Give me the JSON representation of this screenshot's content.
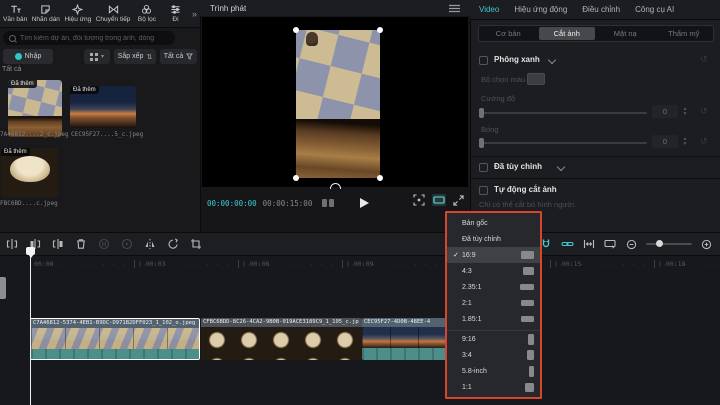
{
  "colors": {
    "accent_cyan": "#3ec9cc",
    "annotation_red": "#d6452c",
    "teal_strip": "#4b8e8a",
    "selection_white": "#ffffff"
  },
  "icons": {
    "more": "»",
    "caret_down": "▾",
    "sort_arrows": "⇅",
    "check": "✓",
    "reset": "↺",
    "step_up": "▲",
    "step_down": "▼"
  },
  "menu_bar": {
    "items": [
      {
        "label": "Văn bản",
        "icon": "text-icon"
      },
      {
        "label": "Nhãn dán",
        "icon": "sticker-icon"
      },
      {
        "label": "Hiệu ứng",
        "icon": "effects-icon"
      },
      {
        "label": "Chuyển tiếp",
        "icon": "transition-icon"
      },
      {
        "label": "Bộ lọc",
        "icon": "filter-icon"
      },
      {
        "label": "Đi",
        "icon": "adjust-icon"
      }
    ]
  },
  "media_panel": {
    "search_placeholder": "Tìm kiếm dự án, đối tượng trong ảnh, dòng",
    "import_label": "Nhập",
    "sort_label": "Sắp xếp",
    "filter_label": "Tất cả",
    "section_label": "Tất cả",
    "items": [
      {
        "badge": "Đã thêm",
        "filename": "7A46812....2_c.jpeg"
      },
      {
        "badge": "Đã thêm",
        "filename": "CEC95F27....5_c.jpeg"
      },
      {
        "badge": "Đã thêm",
        "filename": "FBC6BD....c.jpeg"
      }
    ]
  },
  "player": {
    "title": "Trình phát",
    "current_time": "00:00:00:00",
    "duration": "00:00:15:00"
  },
  "inspector": {
    "tabs": [
      {
        "label": "Video"
      },
      {
        "label": "Hiệu ứng động"
      },
      {
        "label": "Điều chỉnh"
      },
      {
        "label": "Công cụ AI"
      }
    ],
    "subtabs": [
      {
        "label": "Cơ bản"
      },
      {
        "label": "Cắt ảnh"
      },
      {
        "label": "Mặt nạ"
      },
      {
        "label": "Thẩm mỹ"
      }
    ],
    "chroma": {
      "label": "Phông xanh",
      "color_picker_label": "Bộ chọn màu",
      "sliders": [
        {
          "label": "Cường độ",
          "value": "0"
        },
        {
          "label": "Bóng",
          "value": "0"
        }
      ]
    },
    "custom": {
      "label": "Đã tùy chỉnh"
    },
    "autocrop": {
      "label": "Tự động cắt ảnh",
      "hint": "Chỉ có thể cắt bỏ hình người."
    }
  },
  "ratio_menu": {
    "items": [
      {
        "label": "Bản gốc",
        "check": "",
        "icon": "none",
        "row_class": ""
      },
      {
        "label": "Đã tùy chỉnh",
        "check": "",
        "icon": "none",
        "row_class": ""
      },
      {
        "label": "16:9",
        "check": "✓",
        "icon": "r169",
        "row_class": "active"
      },
      {
        "label": "4:3",
        "check": "",
        "icon": "r43",
        "row_class": ""
      },
      {
        "label": "2.35:1",
        "check": "",
        "icon": "r2351",
        "row_class": ""
      },
      {
        "label": "2:1",
        "check": "",
        "icon": "r21",
        "row_class": ""
      },
      {
        "label": "1.85:1",
        "check": "",
        "icon": "r1851",
        "row_class": ""
      },
      {
        "label": "9:16",
        "check": "",
        "icon": "r916",
        "row_class": "sep"
      },
      {
        "label": "3:4",
        "check": "",
        "icon": "r34",
        "row_class": ""
      },
      {
        "label": "5.8-inch",
        "check": "",
        "icon": "r58",
        "row_class": ""
      },
      {
        "label": "1:1",
        "check": "",
        "icon": "r11",
        "row_class": ""
      }
    ]
  },
  "timeline": {
    "ruler": [
      "00:00",
      "| 00:03",
      "| 00:06",
      "| 00:09",
      "| 00:12",
      "| 00:15",
      "| 00:18"
    ],
    "clips": [
      {
        "name": "C7A46812-5374-4EB1-B9DC-D971B2DFF023_1_102_o.jpeg"
      },
      {
        "name": "CFBC6BDD-8C26-4CA2-9B0B-019ACE3189C9_1_105_c.jp"
      },
      {
        "name": "CEC95F27-4D0B-48EE-4"
      }
    ]
  }
}
